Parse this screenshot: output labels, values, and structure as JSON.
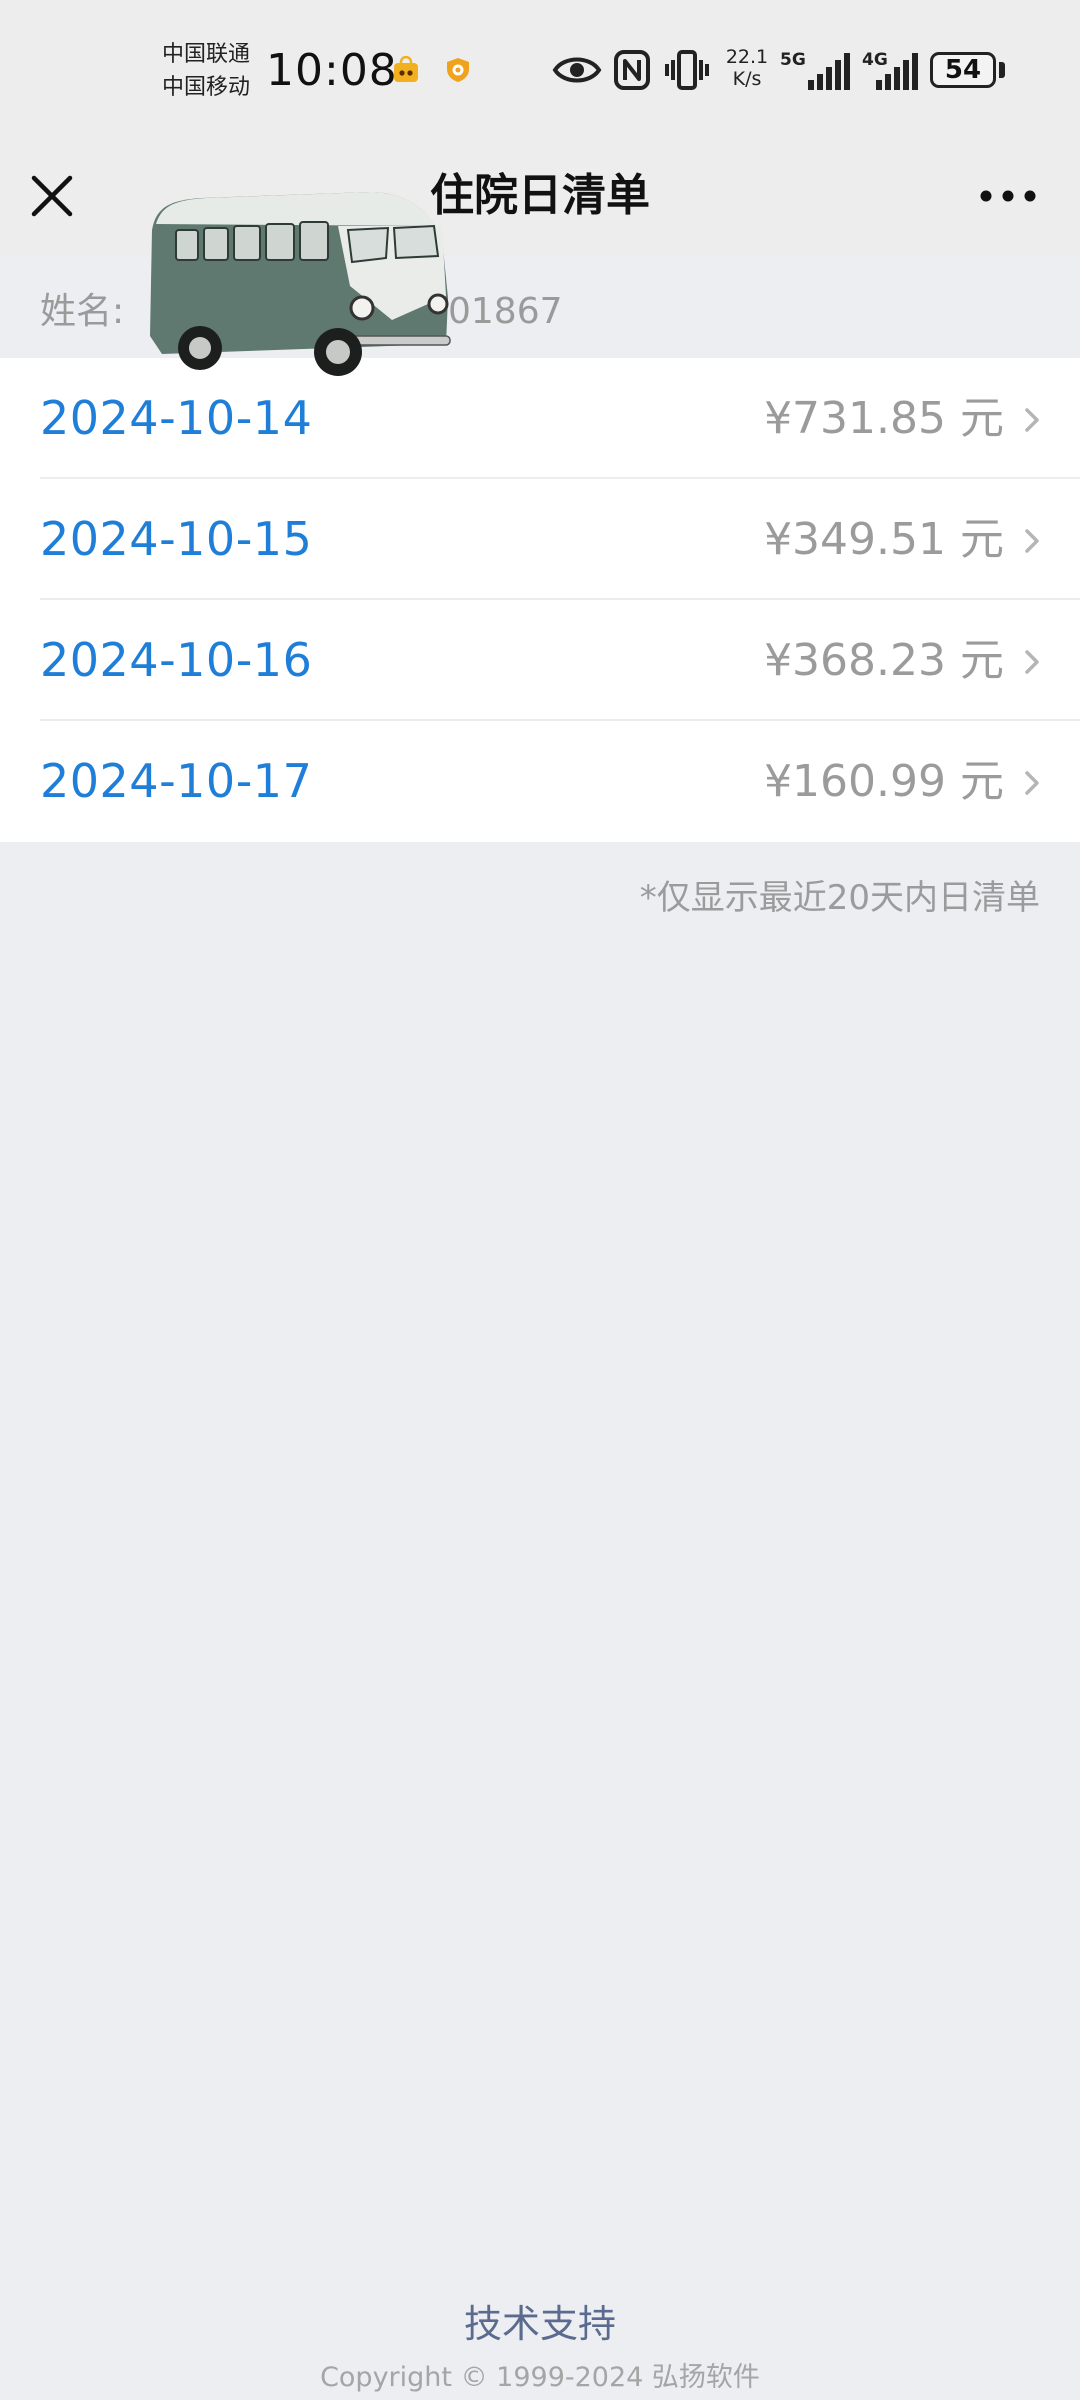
{
  "status_bar": {
    "carrier_1": "中国联通",
    "carrier_2": "中国移动",
    "time": "10:08",
    "net_speed_value": "22.1",
    "net_speed_unit": "K/s",
    "signal_1_label": "5G",
    "signal_2_label": "4G",
    "battery": "54",
    "icons": [
      "shopping-app-icon",
      "shield-app-icon",
      "eye-icon",
      "nfc-icon",
      "vibrate-icon",
      "signal-icon",
      "signal-icon",
      "battery-icon"
    ]
  },
  "nav": {
    "title": "住院日清单",
    "close_icon": "close-icon",
    "more_icon": "more-icon"
  },
  "patient": {
    "name_label": "姓名:",
    "id_suffix": "01867"
  },
  "records": [
    {
      "date": "2024-10-14",
      "amount": "¥731.85 元"
    },
    {
      "date": "2024-10-15",
      "amount": "¥349.51 元"
    },
    {
      "date": "2024-10-16",
      "amount": "¥368.23 元"
    },
    {
      "date": "2024-10-17",
      "amount": "¥160.99 元"
    }
  ],
  "note": "*仅显示最近20天内日清单",
  "footer": {
    "support": "技术支持",
    "copyright": "Copyright © 1999-2024 弘扬软件"
  },
  "colors": {
    "date_blue": "#1f7fd8",
    "amount_gray": "#9b9b9b",
    "page_bg": "#edeef2",
    "bar_bg": "#ededed",
    "footer_link": "#5b6b8f"
  }
}
